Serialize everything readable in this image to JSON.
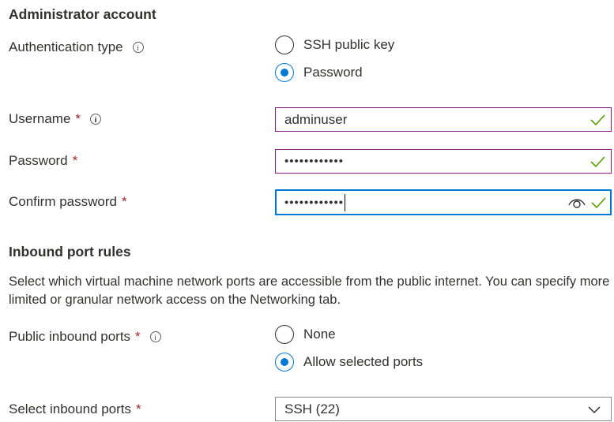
{
  "admin": {
    "heading": "Administrator account",
    "auth_type_label": "Authentication type",
    "auth_options": [
      "SSH public key",
      "Password"
    ],
    "auth_selected": "Password",
    "username_label": "Username",
    "username_value": "adminuser",
    "password_label": "Password",
    "password_value": "••••••••••••",
    "confirm_label": "Confirm password",
    "confirm_value": "••••••••••••",
    "required_marker": "*"
  },
  "inbound": {
    "heading": "Inbound port rules",
    "description": "Select which virtual machine network ports are accessible from the public internet. You can specify more limited or granular network access on the Networking tab.",
    "public_ports_label": "Public inbound ports",
    "port_options": [
      "None",
      "Allow selected ports"
    ],
    "port_selected": "Allow selected ports",
    "select_ports_label": "Select inbound ports",
    "select_ports_value": "SSH (22)"
  },
  "colors": {
    "accent": "#0078d4",
    "required": "#a4262c",
    "valid_check": "#57a300",
    "input_border": "#8a1f8a"
  },
  "icons": [
    "info-icon",
    "check-icon",
    "eye-icon",
    "chevron-down-icon"
  ]
}
